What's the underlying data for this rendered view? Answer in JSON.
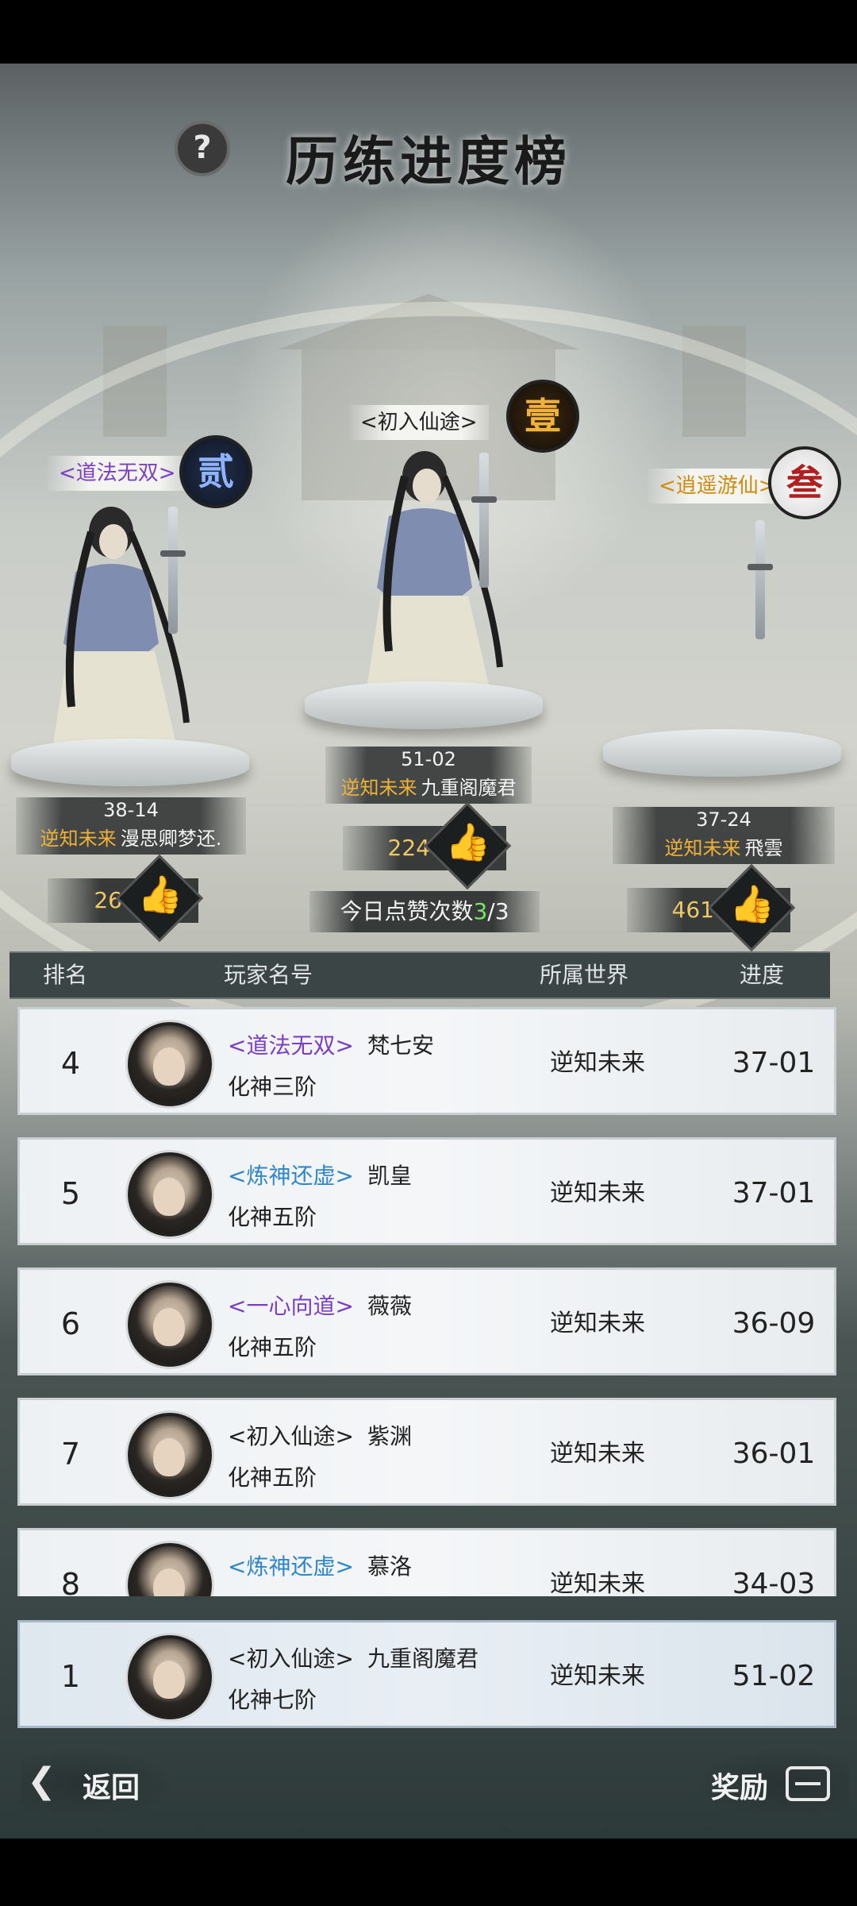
{
  "title": "历练进度榜",
  "help_icon": "?",
  "podium": {
    "first": {
      "sect": "<初入仙途>",
      "rank_seal": "壹",
      "code": "51-02",
      "world": "逆知未来",
      "player": "九重阁魔君",
      "likes": "224"
    },
    "second": {
      "sect": "<道法无双>",
      "rank_seal": "贰",
      "code": "38-14",
      "world": "逆知未来",
      "player": "漫思卿梦还.",
      "likes": "26"
    },
    "third": {
      "sect": "<逍遥游仙>",
      "rank_seal": "叁",
      "code": "37-24",
      "world": "逆知未来",
      "player": "飛雲",
      "likes": "461"
    }
  },
  "daily_likes": {
    "label": "今日点赞次数",
    "used": "3",
    "sep": "/",
    "total": "3"
  },
  "table": {
    "headers": {
      "rank": "排名",
      "name": "玩家名号",
      "world": "所属世界",
      "progress": "进度"
    },
    "rows": [
      {
        "rank": "4",
        "sect": "<道法无双>",
        "name": "梵七安",
        "realm": "化神三阶",
        "world": "逆知未来",
        "progress": "37-01"
      },
      {
        "rank": "5",
        "sect": "<炼神还虚>",
        "name": "凯皇",
        "realm": "化神五阶",
        "world": "逆知未来",
        "progress": "37-01"
      },
      {
        "rank": "6",
        "sect": "<一心向道>",
        "name": "薇薇",
        "realm": "化神五阶",
        "world": "逆知未来",
        "progress": "36-09"
      },
      {
        "rank": "7",
        "sect": "<初入仙途>",
        "name": "紫渊",
        "realm": "化神五阶",
        "world": "逆知未来",
        "progress": "36-01"
      },
      {
        "rank": "8",
        "sect": "<炼神还虚>",
        "name": "慕洛",
        "realm": "",
        "world": "逆知未来",
        "progress": "34-03"
      }
    ],
    "me": {
      "rank": "1",
      "sect": "<初入仙途>",
      "name": "九重阁魔君",
      "realm": "化神七阶",
      "world": "逆知未来",
      "progress": "51-02"
    }
  },
  "footer": {
    "back": "返回",
    "reward": "奖励"
  },
  "colors": {
    "purple_sect": "#7a3fc2",
    "blue_sect": "#2f86c8",
    "gold": "#f0b23a",
    "green_count": "#7be36a"
  }
}
